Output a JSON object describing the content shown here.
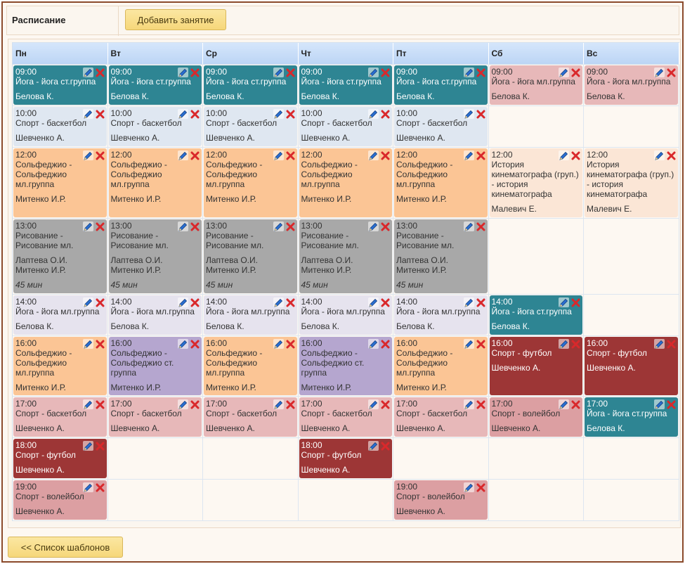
{
  "header": {
    "title": "Расписание",
    "add_button": "Добавить занятие"
  },
  "footer": {
    "templates_button": "<< Список шаблонов"
  },
  "days": [
    "Пн",
    "Вт",
    "Ср",
    "Чт",
    "Пт",
    "Сб",
    "Вс"
  ],
  "icons": {
    "edit": "pencil-icon",
    "delete": "delete-x-icon"
  },
  "colors": {
    "teal": "#2e8593",
    "light": "#dfe7f1",
    "orange": "#fbc595",
    "gray": "#a8a8a8",
    "lavender": "#e6e3ee",
    "purple": "#b5a6cf",
    "pink": "#e7b8b9",
    "darkred": "#9d3636",
    "peach": "#fbe6d6",
    "mauve": "#dc9fa2"
  },
  "events": [
    {
      "day": 0,
      "row": 0,
      "time": "09:00",
      "title": "Йога - йога ст.группа",
      "teacher": "Белова К.",
      "color": "teal"
    },
    {
      "day": 1,
      "row": 0,
      "time": "09:00",
      "title": "Йога - йога ст.группа",
      "teacher": "Белова К.",
      "color": "teal"
    },
    {
      "day": 2,
      "row": 0,
      "time": "09:00",
      "title": "Йога - йога ст.группа",
      "teacher": "Белова К.",
      "color": "teal"
    },
    {
      "day": 3,
      "row": 0,
      "time": "09:00",
      "title": "Йога - йога ст.группа",
      "teacher": "Белова К.",
      "color": "teal"
    },
    {
      "day": 4,
      "row": 0,
      "time": "09:00",
      "title": "Йога - йога ст.группа",
      "teacher": "Белова К.",
      "color": "teal"
    },
    {
      "day": 5,
      "row": 0,
      "time": "09:00",
      "title": "Йога - йога мл.группа",
      "teacher": "Белова К.",
      "color": "pink"
    },
    {
      "day": 6,
      "row": 0,
      "time": "09:00",
      "title": "Йога - йога мл.группа",
      "teacher": "Белова К.",
      "color": "pink"
    },
    {
      "day": 0,
      "row": 1,
      "time": "10:00",
      "title": "Спорт - баскетбол",
      "teacher": "Шевченко А.",
      "color": "light"
    },
    {
      "day": 1,
      "row": 1,
      "time": "10:00",
      "title": "Спорт - баскетбол",
      "teacher": "Шевченко А.",
      "color": "light"
    },
    {
      "day": 2,
      "row": 1,
      "time": "10:00",
      "title": "Спорт - баскетбол",
      "teacher": "Шевченко А.",
      "color": "light"
    },
    {
      "day": 3,
      "row": 1,
      "time": "10:00",
      "title": "Спорт - баскетбол",
      "teacher": "Шевченко А.",
      "color": "light"
    },
    {
      "day": 4,
      "row": 1,
      "time": "10:00",
      "title": "Спорт - баскетбол",
      "teacher": "Шевченко А.",
      "color": "light"
    },
    {
      "day": 0,
      "row": 2,
      "time": "12:00",
      "title": "Сольфеджио -\nСольфеджио\nмл.группа",
      "teacher": "Митенко И.Р.",
      "color": "orange"
    },
    {
      "day": 1,
      "row": 2,
      "time": "12:00",
      "title": "Сольфеджио -\nСольфеджио\nмл.группа",
      "teacher": "Митенко И.Р.",
      "color": "orange"
    },
    {
      "day": 2,
      "row": 2,
      "time": "12:00",
      "title": "Сольфеджио -\nСольфеджио\nмл.группа",
      "teacher": "Митенко И.Р.",
      "color": "orange"
    },
    {
      "day": 3,
      "row": 2,
      "time": "12:00",
      "title": "Сольфеджио -\nСольфеджио\nмл.группа",
      "teacher": "Митенко И.Р.",
      "color": "orange"
    },
    {
      "day": 4,
      "row": 2,
      "time": "12:00",
      "title": "Сольфеджио -\nСольфеджио\nмл.группа",
      "teacher": "Митенко И.Р.",
      "color": "orange"
    },
    {
      "day": 5,
      "row": 2,
      "time": "12:00",
      "title": "История\nкинематографа (груп.)\n- история\nкинематографа",
      "teacher": "Малевич Е.",
      "color": "peach"
    },
    {
      "day": 6,
      "row": 2,
      "time": "12:00",
      "title": "История\nкинематографа (груп.)\n- история\nкинематографа",
      "teacher": "Малевич Е.",
      "color": "peach"
    },
    {
      "day": 0,
      "row": 3,
      "time": "13:00",
      "title": "Рисование -\nРисование мл.",
      "teacher": "Лаптева О.И.\nМитенко И.Р.",
      "duration": "45 мин",
      "color": "gray"
    },
    {
      "day": 1,
      "row": 3,
      "time": "13:00",
      "title": "Рисование -\nРисование мл.",
      "teacher": "Лаптева О.И.\nМитенко И.Р.",
      "duration": "45 мин",
      "color": "gray"
    },
    {
      "day": 2,
      "row": 3,
      "time": "13:00",
      "title": "Рисование -\nРисование мл.",
      "teacher": "Лаптева О.И.\nМитенко И.Р.",
      "duration": "45 мин",
      "color": "gray"
    },
    {
      "day": 3,
      "row": 3,
      "time": "13:00",
      "title": "Рисование -\nРисование мл.",
      "teacher": "Лаптева О.И.\nМитенко И.Р.",
      "duration": "45 мин",
      "color": "gray"
    },
    {
      "day": 4,
      "row": 3,
      "time": "13:00",
      "title": "Рисование -\nРисование мл.",
      "teacher": "Лаптева О.И.\nМитенко И.Р.",
      "duration": "45 мин",
      "color": "gray"
    },
    {
      "day": 0,
      "row": 4,
      "time": "14:00",
      "title": "Йога - йога мл.группа",
      "teacher": "Белова К.",
      "color": "lavender"
    },
    {
      "day": 1,
      "row": 4,
      "time": "14:00",
      "title": "Йога - йога мл.группа",
      "teacher": "Белова К.",
      "color": "lavender"
    },
    {
      "day": 2,
      "row": 4,
      "time": "14:00",
      "title": "Йога - йога мл.группа",
      "teacher": "Белова К.",
      "color": "lavender"
    },
    {
      "day": 3,
      "row": 4,
      "time": "14:00",
      "title": "Йога - йога мл.группа",
      "teacher": "Белова К.",
      "color": "lavender"
    },
    {
      "day": 4,
      "row": 4,
      "time": "14:00",
      "title": "Йога - йога мл.группа",
      "teacher": "Белова К.",
      "color": "lavender"
    },
    {
      "day": 5,
      "row": 4,
      "time": "14:00",
      "title": "Йога - йога ст.группа",
      "teacher": "Белова К.",
      "color": "teal"
    },
    {
      "day": 0,
      "row": 5,
      "time": "16:00",
      "title": "Сольфеджио -\nСольфеджио\nмл.группа",
      "teacher": "Митенко И.Р.",
      "color": "orange"
    },
    {
      "day": 1,
      "row": 5,
      "time": "16:00",
      "title": "Сольфеджио -\nСольфеджио ст.\nгруппа",
      "teacher": "Митенко И.Р.",
      "color": "purple"
    },
    {
      "day": 2,
      "row": 5,
      "time": "16:00",
      "title": "Сольфеджио -\nСольфеджио\nмл.группа",
      "teacher": "Митенко И.Р.",
      "color": "orange"
    },
    {
      "day": 3,
      "row": 5,
      "time": "16:00",
      "title": "Сольфеджио -\nСольфеджио ст.\nгруппа",
      "teacher": "Митенко И.Р.",
      "color": "purple"
    },
    {
      "day": 4,
      "row": 5,
      "time": "16:00",
      "title": "Сольфеджио -\nСольфеджио\nмл.группа",
      "teacher": "Митенко И.Р.",
      "color": "orange"
    },
    {
      "day": 5,
      "row": 5,
      "time": "16:00",
      "title": "Спорт - футбол",
      "teacher": "Шевченко А.",
      "color": "darkred"
    },
    {
      "day": 6,
      "row": 5,
      "time": "16:00",
      "title": "Спорт - футбол",
      "teacher": "Шевченко А.",
      "color": "darkred"
    },
    {
      "day": 0,
      "row": 6,
      "time": "17:00",
      "title": "Спорт - баскетбол",
      "teacher": "Шевченко А.",
      "color": "pink"
    },
    {
      "day": 1,
      "row": 6,
      "time": "17:00",
      "title": "Спорт - баскетбол",
      "teacher": "Шевченко А.",
      "color": "pink"
    },
    {
      "day": 2,
      "row": 6,
      "time": "17:00",
      "title": "Спорт - баскетбол",
      "teacher": "Шевченко А.",
      "color": "pink"
    },
    {
      "day": 3,
      "row": 6,
      "time": "17:00",
      "title": "Спорт - баскетбол",
      "teacher": "Шевченко А.",
      "color": "pink"
    },
    {
      "day": 4,
      "row": 6,
      "time": "17:00",
      "title": "Спорт - баскетбол",
      "teacher": "Шевченко А.",
      "color": "pink"
    },
    {
      "day": 5,
      "row": 6,
      "time": "17:00",
      "title": "Спорт - волейбол",
      "teacher": "Шевченко А.",
      "color": "mauve"
    },
    {
      "day": 6,
      "row": 6,
      "time": "17:00",
      "title": "Йога - йога ст.группа",
      "teacher": "Белова К.",
      "color": "teal"
    },
    {
      "day": 0,
      "row": 7,
      "time": "18:00",
      "title": "Спорт - футбол",
      "teacher": "Шевченко А.",
      "color": "darkred"
    },
    {
      "day": 3,
      "row": 7,
      "time": "18:00",
      "title": "Спорт - футбол",
      "teacher": "Шевченко А.",
      "color": "darkred"
    },
    {
      "day": 0,
      "row": 8,
      "time": "19:00",
      "title": "Спорт - волейбол",
      "teacher": "Шевченко А.",
      "color": "mauve"
    },
    {
      "day": 4,
      "row": 8,
      "time": "19:00",
      "title": "Спорт - волейбол",
      "teacher": "Шевченко А.",
      "color": "mauve"
    }
  ]
}
